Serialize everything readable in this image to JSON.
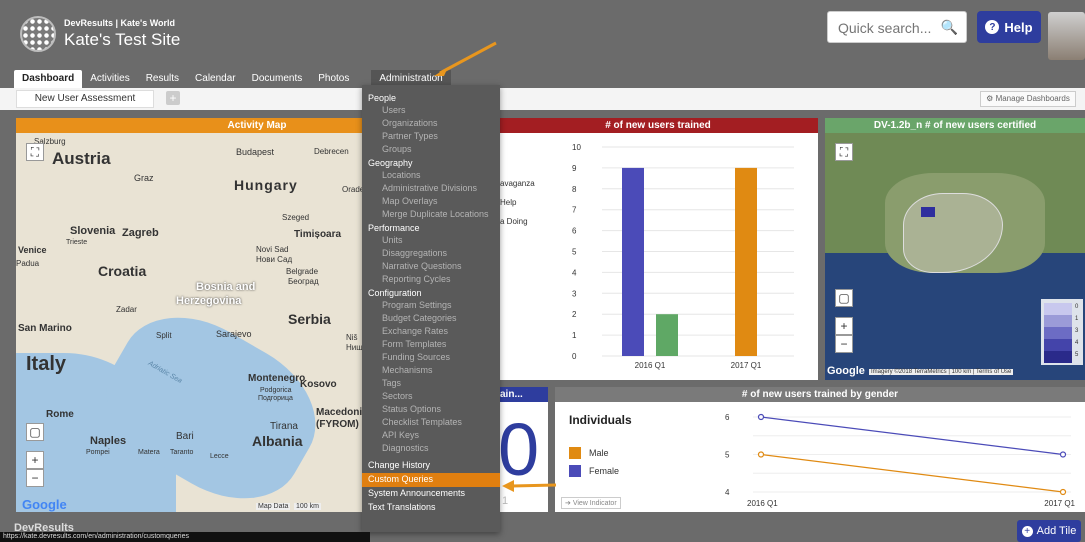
{
  "header": {
    "org_line": "DevResults | Kate's World",
    "site_name": "Kate's Test Site",
    "search_placeholder": "Quick search...",
    "help_label": "Help"
  },
  "nav": {
    "tabs": [
      {
        "label": "Dashboard"
      },
      {
        "label": "Activities"
      },
      {
        "label": "Results"
      },
      {
        "label": "Calendar"
      },
      {
        "label": "Documents"
      },
      {
        "label": "Photos"
      },
      {
        "label": "Administration"
      }
    ]
  },
  "dashboard": {
    "tab_label": "New User Assessment",
    "add_label": "+",
    "manage_label": "Manage Dashboards"
  },
  "tiles": {
    "activity_map": {
      "title": "Activity Map",
      "labels": [
        "Salzburg",
        "Austria",
        "Graz",
        "Budapest",
        "Debrecen",
        "Hungary",
        "Oradea",
        "Szeged",
        "Slovenia",
        "Zagreb",
        "Timișoara",
        "Venice",
        "Trieste",
        "Padua",
        "Croatia",
        "Novi Sad",
        "Нови Сад",
        "Belgrade",
        "Београд",
        "Bosnia and",
        "Herzegovina",
        "Zadar",
        "San Marino",
        "Split",
        "Sarajevo",
        "Serbia",
        "Niš",
        "Ниш",
        "Italy",
        "Adriatic Sea",
        "Montenegro",
        "Podgorica",
        "Подгорица",
        "Kosovo",
        "Rome",
        "Bari",
        "Tirana",
        "Albania",
        "Macedonia",
        "(FYROM)",
        "Naples",
        "Pompei",
        "Matera",
        "Taranto",
        "Lecce",
        "Google",
        "Map Data",
        "100 km"
      ]
    },
    "users_trained": {
      "title": "# of new users trained",
      "partial_labels": [
        "avaganza",
        "Help",
        "a Doing"
      ]
    },
    "certified": {
      "title": "DV-1.2b_n # of new users certified",
      "legend": [
        "0",
        "1",
        "3",
        "4",
        "5"
      ],
      "attribution": "Imagery ©2018 TerraMetrics | 100 km | Terms of Use"
    },
    "partial_tile": {
      "title": "ain...",
      "big_value": "0",
      "small_value": "1"
    },
    "by_gender": {
      "title": "# of new users trained by gender",
      "section_label": "Individuals",
      "legend": [
        {
          "label": "Male",
          "color": "#e08a12"
        },
        {
          "label": "Female",
          "color": "#4b4bb8"
        }
      ],
      "view_indicator": "View Indicator"
    }
  },
  "admin_menu": {
    "sections": [
      {
        "head": "People",
        "items": [
          "Users",
          "Organizations",
          "Partner Types",
          "Groups"
        ]
      },
      {
        "head": "Geography",
        "items": [
          "Locations",
          "Administrative Divisions",
          "Map Overlays",
          "Merge Duplicate Locations"
        ]
      },
      {
        "head": "Performance",
        "items": [
          "Units",
          "Disaggregations",
          "Narrative Questions",
          "Reporting Cycles"
        ]
      },
      {
        "head": "Configuration",
        "items": [
          "Program Settings",
          "Budget Categories",
          "Exchange Rates",
          "Form Templates",
          "Funding Sources",
          "Mechanisms",
          "Tags",
          "Sectors",
          "Status Options",
          "Checklist Templates",
          "API Keys",
          "Diagnostics"
        ]
      }
    ],
    "top_items": [
      "Change History",
      "Custom Queries",
      "System Announcements",
      "Text Translations"
    ],
    "selected": "Custom Queries"
  },
  "footer": {
    "status_url": "https://kate.devresults.com/en/administration/customqueries",
    "logo_text": "DevResults",
    "add_tile_label": "Add Tile"
  },
  "chart_data": [
    {
      "type": "bar",
      "title": "# of new users trained",
      "categories": [
        "2016 Q1",
        "2017 Q1"
      ],
      "series": [
        {
          "values": [
            9,
            null
          ],
          "color": "#4b4bb8"
        },
        {
          "values": [
            2,
            null
          ],
          "color": "#5fa865"
        },
        {
          "values": [
            null,
            9
          ],
          "color": "#e08a12"
        }
      ],
      "ylim": [
        0,
        10
      ],
      "yticks": [
        0,
        1,
        2,
        3,
        4,
        5,
        6,
        7,
        8,
        9,
        10
      ]
    },
    {
      "type": "line",
      "title": "# of new users trained by gender",
      "categories": [
        "2016 Q1",
        "2017 Q1"
      ],
      "series": [
        {
          "name": "Male",
          "values": [
            5,
            4
          ],
          "color": "#e08a12"
        },
        {
          "name": "Female",
          "values": [
            6,
            5
          ],
          "color": "#4b4bb8"
        }
      ],
      "ylim": [
        4,
        6
      ],
      "yticks": [
        4,
        5,
        6
      ]
    }
  ],
  "colors": {
    "accent_orange": "#e07f10",
    "activity_map_header": "#e8901a",
    "trained_header": "#a31e22",
    "certified_header": "#6aa56a",
    "brand_blue": "#2e3d9e"
  }
}
